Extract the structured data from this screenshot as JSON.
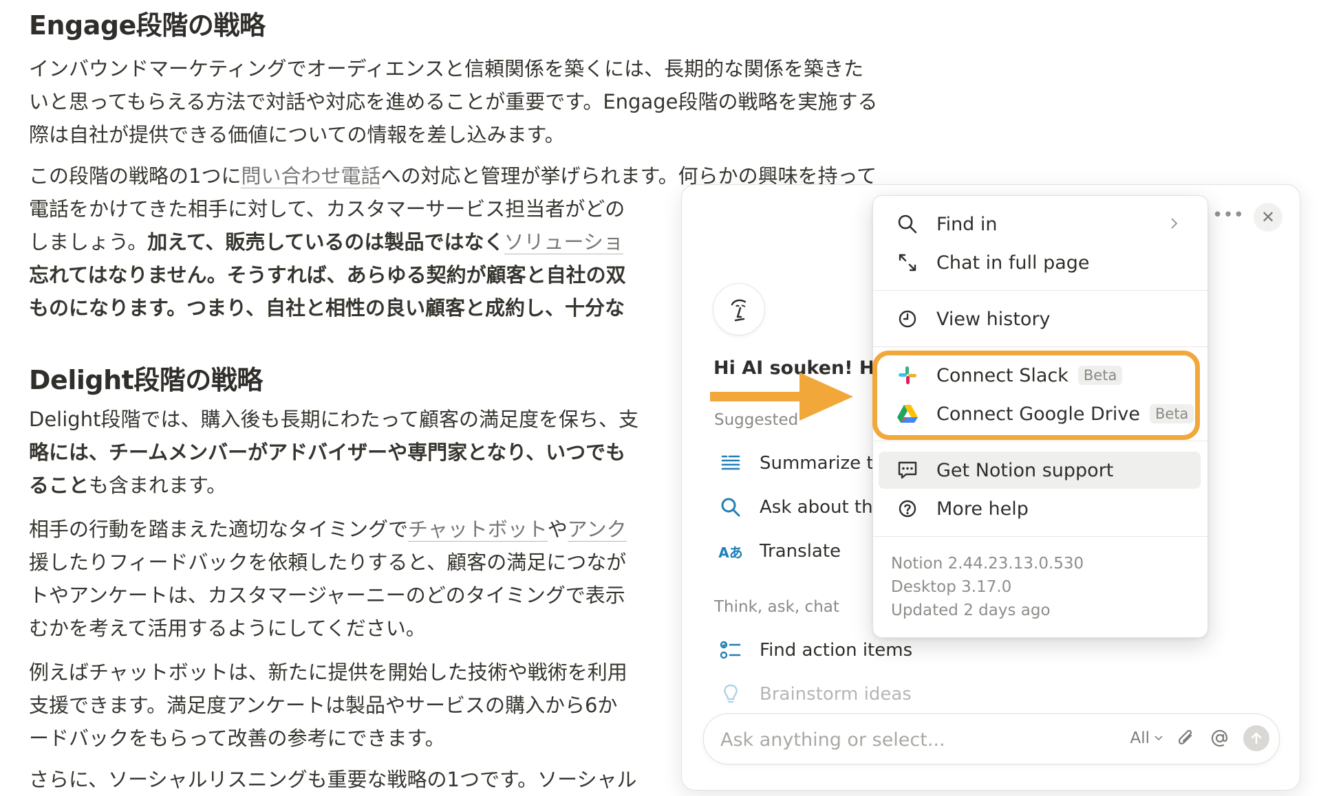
{
  "document": {
    "h_engage": "Engage段階の戦略",
    "p1_lines": [
      "インバウンドマーケティングでオーディエンスと信頼関係を築くには、長期的な関係を築きた",
      "いと思ってもらえる方法で対話や対応を進めることが重要です。Engage段階の戦略を実施する",
      "際は自社が提供できる価値についての情報を差し込みます。"
    ],
    "p2_l1_a": "この段階の戦略の1つに",
    "p2_l1_link": "問い合わせ電話",
    "p2_l1_b": "への対応と管理が挙げられます。何らかの興味を持って",
    "p2_l2": "電話をかけてきた相手に対して、カスタマーサービス担当者がどの",
    "p2_l3_a": "しましょう。",
    "p2_l3_bold": "加えて、販売しているのは製品ではなく",
    "p2_l3_link": "ソリューショ",
    "p2_l4": "忘れてはなりません。そうすれば、あらゆる契約が顧客と自社の双",
    "p2_l5": "ものになります。つまり、自社と相性の良い顧客と成約し、十分な",
    "h_delight": "Delight段階の戦略",
    "p3_l1": "Delight段階では、購入後も長期にわたって顧客の満足度を保ち、支",
    "p3_l2": "略には、チームメンバーがアドバイザーや専門家となり、いつでも",
    "p3_l3_bold": "ること",
    "p3_l3_rest": "も含まれます。",
    "p4_l1_a": "相手の行動を踏まえた適切なタイミングで",
    "p4_l1_link1": "チャットボット",
    "p4_l1_b": "や",
    "p4_l1_link2": "アンク",
    "p4_l2": "援したりフィードバックを依頼したりすると、顧客の満足につなが",
    "p4_l3": "トやアンケートは、カスタマージャーニーのどのタイミングで表示",
    "p4_l4": "むかを考えて活用するようにしてください。",
    "p5_l1": "例えばチャットボットは、新たに提供を開始した技術や戦術を利用",
    "p5_l2": "支援できます。満足度アンケートは製品やサービスの購入から6か",
    "p5_l3": "ードバックをもらって改善の参考にできます。",
    "p6_l1": "さらに、ソーシャルリスニングも重要な戦略の1つです。ソーシャル"
  },
  "ai_panel": {
    "greeting": "Hi AI souken! How",
    "suggested_label": "Suggested",
    "suggestions": [
      {
        "label": "Summarize th",
        "icon": "summarize-icon"
      },
      {
        "label": "Ask about this",
        "icon": "search-icon"
      },
      {
        "label": "Translate",
        "icon": "translate-icon"
      }
    ],
    "think_label": "Think, ask, chat",
    "think_items": [
      {
        "label": "Find action items",
        "icon": "checklist-icon"
      },
      {
        "label": "Brainstorm ideas",
        "icon": "lightbulb-icon"
      }
    ],
    "input_placeholder": "Ask anything or select...",
    "scope_label": "All",
    "more_label": "•••",
    "close_label": "✕"
  },
  "menu": {
    "items": [
      {
        "label": "Find in",
        "icon": "search-icon"
      },
      {
        "label": "Chat in full page",
        "icon": "expand-icon"
      },
      {
        "label": "View history",
        "icon": "clock-icon"
      },
      {
        "label": "Connect Slack",
        "icon": "slack-icon",
        "badge": "Beta"
      },
      {
        "label": "Connect Google Drive",
        "icon": "google-drive-icon",
        "badge": "Beta"
      },
      {
        "label": "Get Notion support",
        "icon": "chat-bubble-icon"
      },
      {
        "label": "More help",
        "icon": "question-circle-icon"
      }
    ],
    "version": "Notion 2.44.23.13.0.530",
    "desktop": "Desktop 3.17.0",
    "updated": "Updated 2 days ago"
  },
  "colors": {
    "highlight": "#f1a73a",
    "link_gray": "#787774",
    "text": "#37352f"
  }
}
